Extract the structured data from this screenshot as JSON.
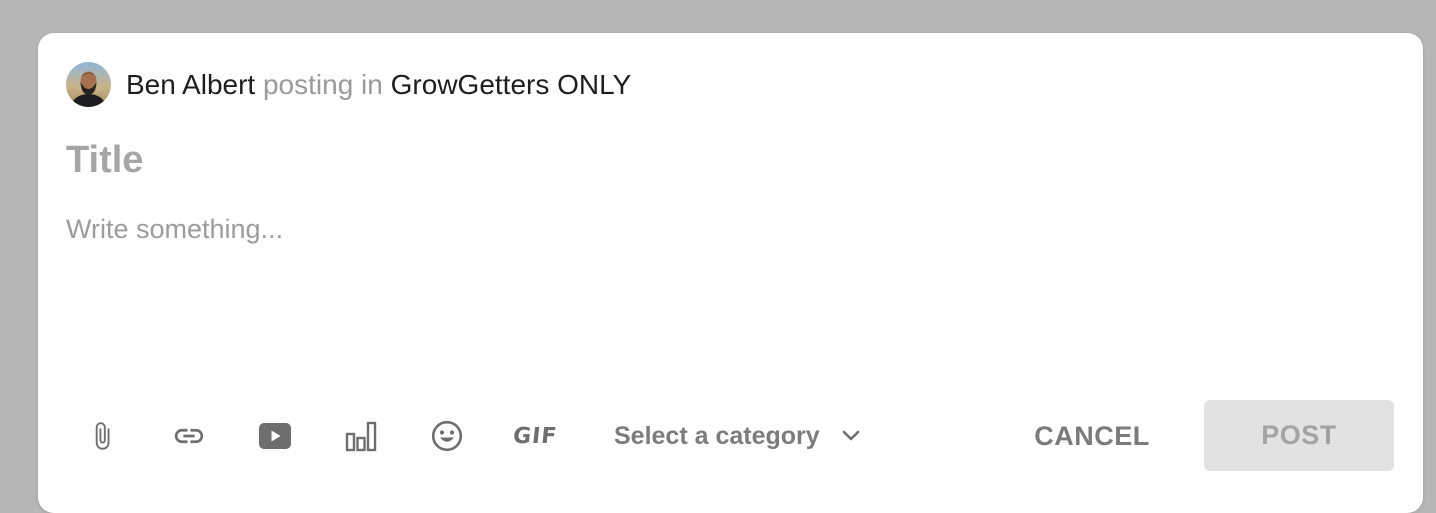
{
  "composer": {
    "author_name": "Ben Albert",
    "posting_in_text": "posting in",
    "group_name": "GrowGetters ONLY",
    "title_placeholder": "Title",
    "body_placeholder": "Write something..."
  },
  "toolbar": {
    "icons": [
      "paperclip-icon",
      "link-icon",
      "youtube-icon",
      "poll-icon",
      "emoji-icon",
      "gif-icon"
    ],
    "gif_label": "GIF",
    "category_label": "Select a category",
    "cancel_label": "CANCEL",
    "post_label": "POST"
  },
  "colors": {
    "page_background": "#b6b6b6",
    "card_background": "#ffffff",
    "icon_gray": "#6e6e6e",
    "post_button_disabled_bg": "#e2e2e2",
    "post_button_disabled_text": "#a3a3a3"
  }
}
